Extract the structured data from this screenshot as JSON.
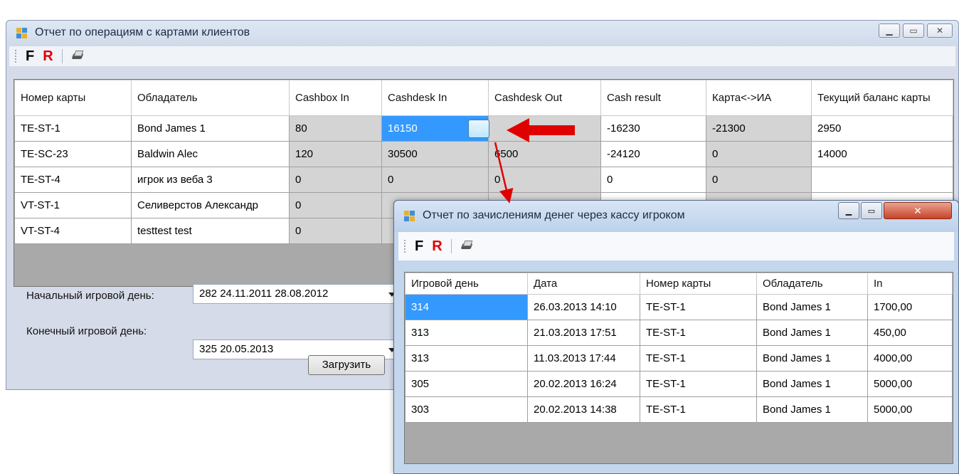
{
  "main_window": {
    "title": "Отчет по операциям с картами клиентов",
    "toolbar": {
      "f_label": "F",
      "r_label": "R",
      "print_icon": "printer-icon"
    },
    "grid": {
      "columns": [
        "Номер карты",
        "Обладатель",
        "Cashbox In",
        "Cashdesk In",
        "Cashdesk Out",
        "Cash result",
        "Карта<->ИА",
        "Текущий баланс карты"
      ],
      "rows": [
        [
          "TE-ST-1",
          "Bond James 1",
          "80",
          "16150",
          "",
          "-16230",
          "-21300",
          "2950"
        ],
        [
          "TE-SC-23",
          "Baldwin Alec",
          "120",
          "30500",
          "6500",
          "-24120",
          "0",
          "14000"
        ],
        [
          "TE-ST-4",
          "игрок из веба 3",
          "0",
          "0",
          "0",
          "0",
          "0",
          ""
        ],
        [
          "VT-ST-1",
          "Селиверстов Александр",
          "0",
          "",
          "",
          "",
          "",
          ""
        ],
        [
          "VT-ST-4",
          "testtest test",
          "0",
          "",
          "",
          "",
          "",
          ""
        ]
      ],
      "cell_button_label": ".."
    },
    "start_day_label": "Начальный игровой день:",
    "start_day_value": "282 24.11.2011 28.08.2012",
    "end_day_label": "Конечный игровой день:",
    "end_day_value": "325 20.05.2013",
    "load_button": "Загрузить"
  },
  "detail_window": {
    "title": "Отчет по зачислениям денег через кассу игроком",
    "toolbar": {
      "f_label": "F",
      "r_label": "R",
      "print_icon": "printer-icon"
    },
    "grid": {
      "columns": [
        "Игровой день",
        "Дата",
        "Номер карты",
        "Обладатель",
        "In"
      ],
      "rows": [
        [
          "314",
          "26.03.2013 14:10",
          "TE-ST-1",
          "Bond James 1",
          "1700,00"
        ],
        [
          "313",
          "21.03.2013 17:51",
          "TE-ST-1",
          "Bond James 1",
          "450,00"
        ],
        [
          "313",
          "11.03.2013 17:44",
          "TE-ST-1",
          "Bond James 1",
          "4000,00"
        ],
        [
          "305",
          "20.02.2013 16:24",
          "TE-ST-1",
          "Bond James 1",
          "5000,00"
        ],
        [
          "303",
          "20.02.2013 14:38",
          "TE-ST-1",
          "Bond James 1",
          "5000,00"
        ]
      ]
    }
  },
  "annotation_color": "#e00000"
}
